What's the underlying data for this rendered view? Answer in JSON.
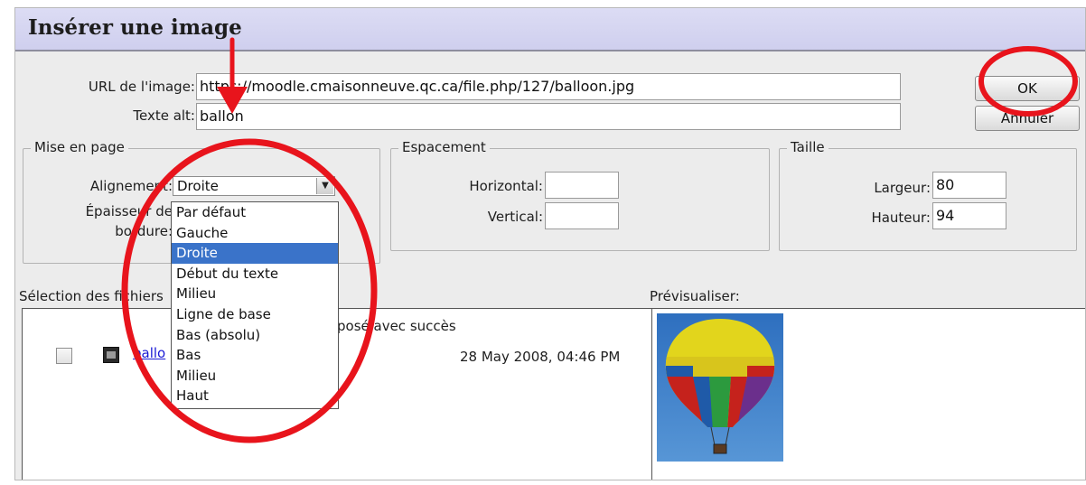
{
  "dialog": {
    "title": "Insérer une image",
    "url_label": "URL de l'image:",
    "url_value": "https://moodle.cmaisonneuve.qc.ca/file.php/127/balloon.jpg",
    "alt_label": "Texte alt:",
    "alt_value": "ballon",
    "ok_label": "OK",
    "cancel_label": "Annuler"
  },
  "layout_group": {
    "legend": "Mise en page",
    "alignment_label": "Alignement:",
    "border_label_line1": "Épaisseur de",
    "border_label_line2": "bordure:",
    "alignment_selected": "Droite",
    "options": [
      "Par défaut",
      "Gauche",
      "Droite",
      "Début du texte",
      "Milieu",
      "Ligne de base",
      "Bas (absolu)",
      "Bas",
      "Milieu",
      "Haut"
    ]
  },
  "spacing_group": {
    "legend": "Espacement",
    "horizontal_label": "Horizontal:",
    "horizontal_value": "",
    "vertical_label": "Vertical:",
    "vertical_value": ""
  },
  "size_group": {
    "legend": "Taille",
    "width_label": "Largeur:",
    "width_value": "80",
    "height_label": "Hauteur:",
    "height_value": "94"
  },
  "file_browser": {
    "label": "Sélection des fichiers",
    "status": "posé avec succès",
    "file_name": "ballo",
    "file_date": "28 May 2008, 04:46 PM"
  },
  "preview": {
    "label": "Prévisualiser:"
  },
  "annotations": {
    "color": "#e8141c"
  }
}
